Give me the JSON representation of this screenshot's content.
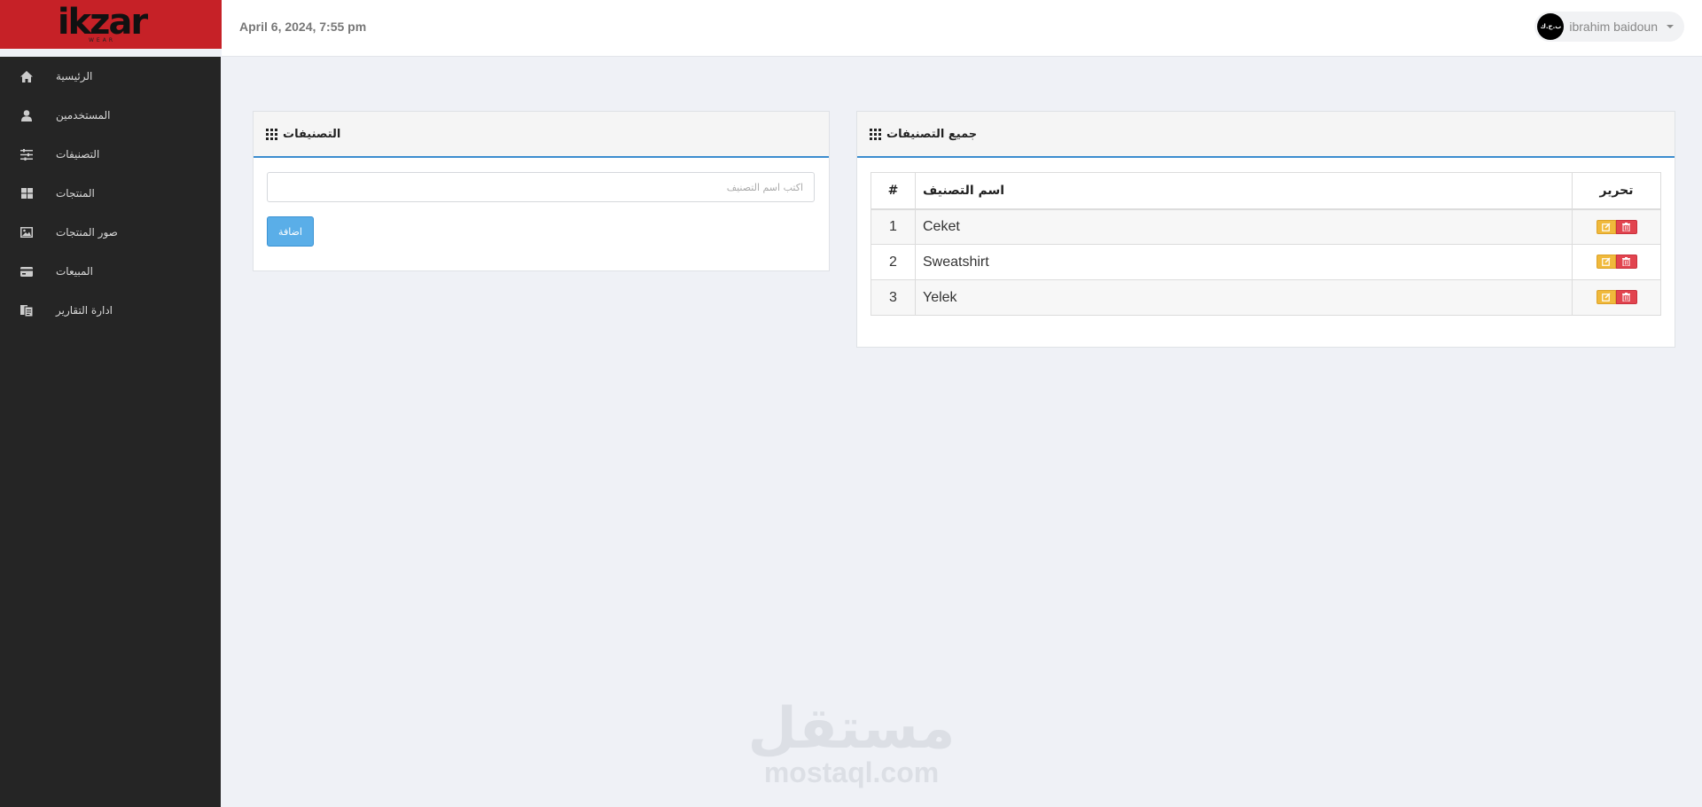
{
  "brand": {
    "name": "ikzar",
    "sub": "WEAR"
  },
  "header": {
    "datetime": "April 6, 2024, 7:55 pm",
    "user": {
      "name": "ibrahim baidoun",
      "avatar_text": "ب.ح.ك"
    }
  },
  "sidebar": {
    "items": [
      {
        "label": "الرئيسية",
        "icon": "home-icon"
      },
      {
        "label": "المستخدمين",
        "icon": "user-icon"
      },
      {
        "label": "التصنيفات",
        "icon": "sliders-icon"
      },
      {
        "label": "المنتجات",
        "icon": "grid-icon"
      },
      {
        "label": "صور المنتجات",
        "icon": "image-icon"
      },
      {
        "label": "المبيعات",
        "icon": "card-icon"
      },
      {
        "label": "ادارة التقارير",
        "icon": "files-icon"
      }
    ]
  },
  "add_panel": {
    "title": "التصنيفات",
    "input_placeholder": "اكتب اسم التصنيف",
    "input_value": "",
    "submit_label": "اضافة"
  },
  "list_panel": {
    "title": "جميع التصنيفات",
    "columns": {
      "num": "#",
      "name": "اسم التصنيف",
      "edit": "تحرير"
    },
    "rows": [
      {
        "num": "1",
        "name": "Ceket"
      },
      {
        "num": "2",
        "name": "Sweatshirt"
      },
      {
        "num": "3",
        "name": "Yelek"
      }
    ]
  },
  "watermark": {
    "arabic": "مستقل",
    "latin": "mostaql.com"
  },
  "colors": {
    "brand_red": "#c62127",
    "sidebar_bg": "#252525",
    "accent_blue": "#3c8dcf",
    "edit_yellow": "#f0b93b",
    "delete_red": "#e2444f"
  }
}
